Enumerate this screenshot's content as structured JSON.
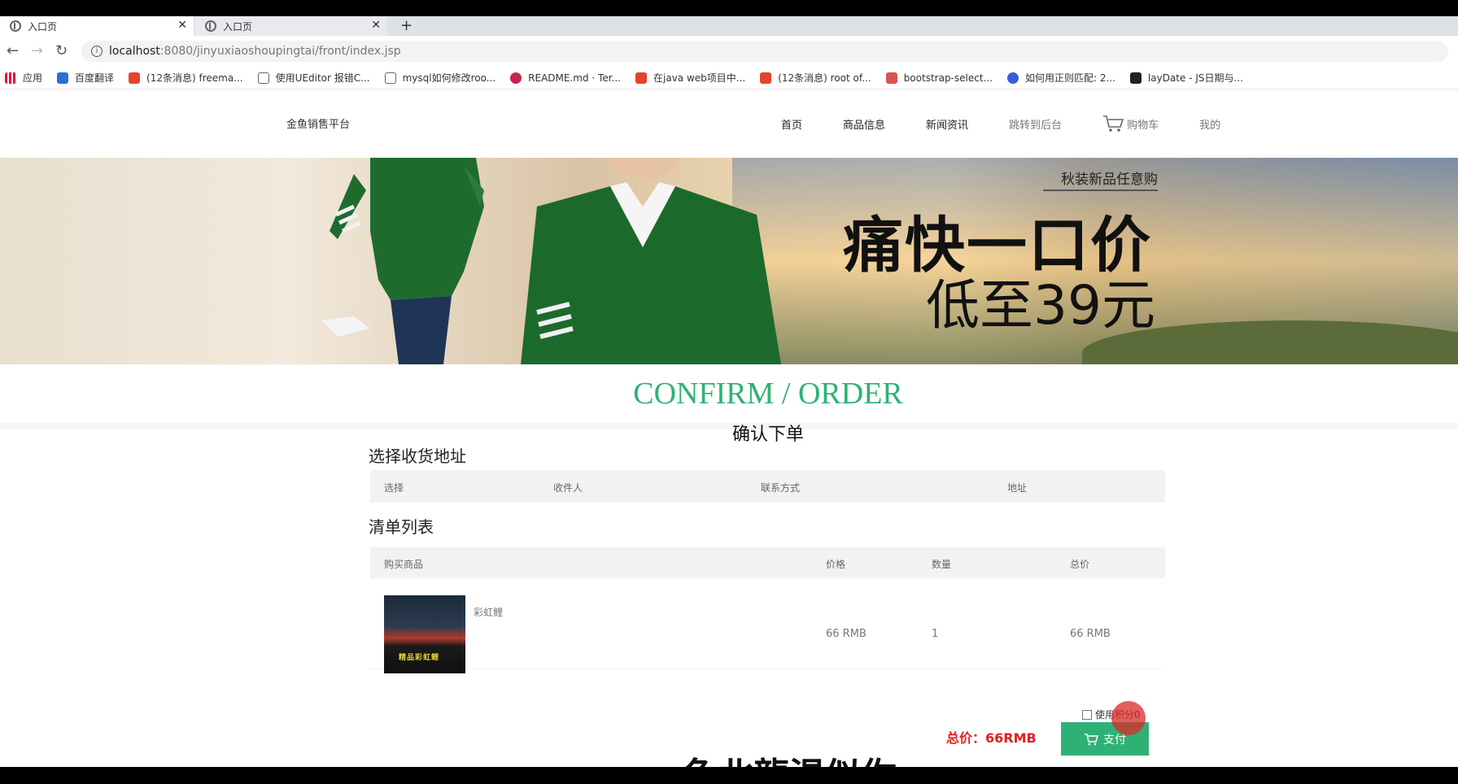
{
  "browser": {
    "tabs": [
      {
        "title": "入口页",
        "active": true
      },
      {
        "title": "入口页",
        "active": false
      }
    ],
    "new_tab_label": "+",
    "url_host": "localhost",
    "url_path": ":8080/jinyuxiaoshoupingtai/front/index.jsp",
    "bookmarks": [
      "应用",
      "百度翻译",
      "(12条消息) freema...",
      "使用UEditor 报错C...",
      "mysql如何修改roo...",
      "README.md · Ter...",
      "在java web项目中...",
      "(12条消息) root of...",
      "bootstrap-select...",
      "如何用正则匹配: 2...",
      "layDate - JS日期与..."
    ]
  },
  "site": {
    "logo": "金鱼销售平台",
    "nav": [
      "首页",
      "商品信息",
      "新闻资讯",
      "跳转到后台",
      "购物车",
      "我的"
    ]
  },
  "banner": {
    "subtitle": "秋装新品任意购",
    "title": "痛快一口价",
    "price_line": "低至39元"
  },
  "confirm": {
    "title_en": "CONFIRM / ORDER",
    "title_cn": "确认下单"
  },
  "address_section": {
    "title": "选择收货地址",
    "columns": [
      "选择",
      "收件人",
      "联系方式",
      "地址"
    ]
  },
  "list_section": {
    "title": "清单列表",
    "columns": [
      "购买商品",
      "价格",
      "数量",
      "总价"
    ],
    "rows": [
      {
        "name": "彩虹鲤",
        "thumb_caption": "精品彩虹鲤",
        "price": "66 RMB",
        "qty": "1",
        "total": "66 RMB"
      }
    ]
  },
  "checkout": {
    "points_label": "使用积分0",
    "total_label": "总价：66RMB",
    "pay_button": "支付"
  },
  "footer_peek": "鱼北龍渴似你"
}
